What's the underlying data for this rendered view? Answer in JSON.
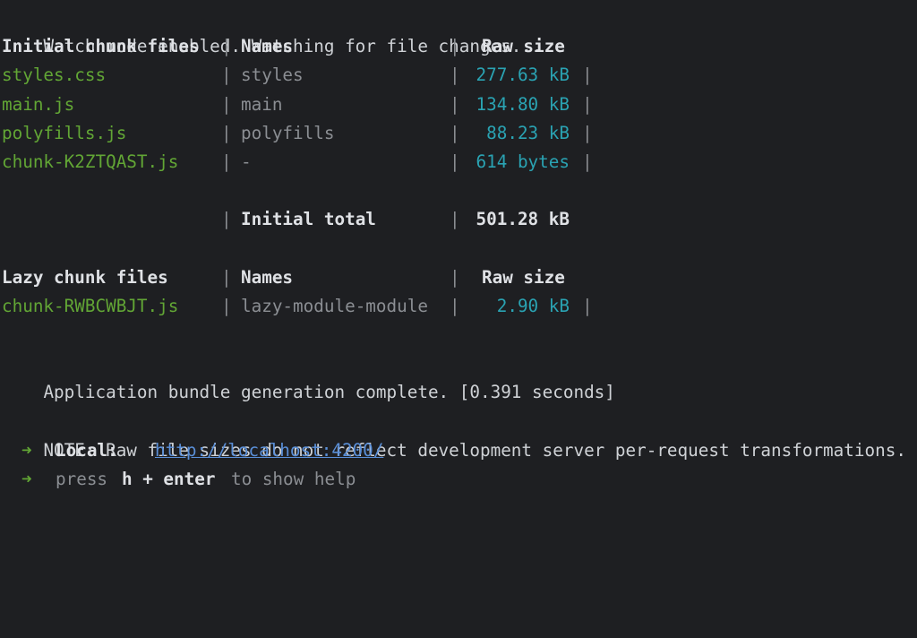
{
  "header_line": "Watch mode enabled. Watching for file changes...",
  "initial_table": {
    "headers": {
      "file": "Initial chunk files",
      "names": "Names",
      "size": "Raw size"
    },
    "rows": [
      {
        "file": "styles.css",
        "name": "styles",
        "size": "277.63 kB"
      },
      {
        "file": "main.js",
        "name": "main",
        "size": "134.80 kB"
      },
      {
        "file": "polyfills.js",
        "name": "polyfills",
        "size": "88.23 kB"
      },
      {
        "file": "chunk-K2ZTQAST.js",
        "name": "-",
        "size": "614 bytes"
      }
    ],
    "total_label": "Initial total",
    "total_size": "501.28 kB"
  },
  "lazy_table": {
    "headers": {
      "file": "Lazy chunk files",
      "names": "Names",
      "size": "Raw size"
    },
    "rows": [
      {
        "file": "chunk-RWBCWBJT.js",
        "name": "lazy-module-module",
        "size": "2.90 kB"
      }
    ]
  },
  "separator": "|",
  "complete_line": "Application bundle generation complete. [0.391 seconds]",
  "note_line": "NOTE: Raw file sizes do not reflect development server per-request transformations.",
  "local": {
    "arrow": "➜",
    "label": "Local:",
    "url": "http://localhost:4200/"
  },
  "help": {
    "arrow": "➜",
    "prefix": "press",
    "keys": "h + enter",
    "suffix": "to show help"
  },
  "colors": {
    "background": "#1e1f22",
    "file_green": "#62a635",
    "size_cyan": "#2aa3b3",
    "link_blue": "#5a8fd8"
  }
}
